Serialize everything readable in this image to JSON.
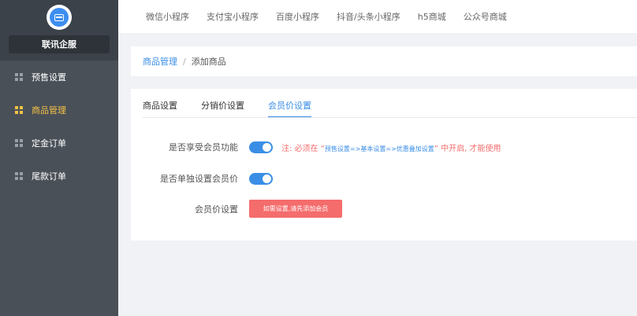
{
  "sidebar": {
    "brand": "联讯企服",
    "items": [
      {
        "label": "预售设置"
      },
      {
        "label": "商品管理"
      },
      {
        "label": "定金订单"
      },
      {
        "label": "尾款订单"
      }
    ],
    "active_color": "#f5c244"
  },
  "topbar": {
    "items": [
      "微信小程序",
      "支付宝小程序",
      "百度小程序",
      "抖音/头条小程序",
      "h5商城",
      "公众号商城"
    ]
  },
  "breadcrumb": {
    "parent": "商品管理",
    "separator": "/",
    "current": "添加商品"
  },
  "tabs": [
    "商品设置",
    "分销价设置",
    "会员价设置"
  ],
  "form": {
    "member_feature": {
      "label": "是否享受会员功能",
      "enabled": true,
      "note_prefix": "注: 必须在 “",
      "note_path": "预售设置=>基本设置=>优惠叠加设置",
      "note_suffix": "” 中开启, 才能使用"
    },
    "separate_price": {
      "label": "是否单独设置会员价",
      "enabled": true
    },
    "member_price": {
      "label": "会员价设置",
      "button": "如需设置,请先添加会员"
    }
  },
  "colors": {
    "accent": "#3a8ee6",
    "danger": "#f56c6c",
    "sidebar_bg": "#4a5058"
  }
}
